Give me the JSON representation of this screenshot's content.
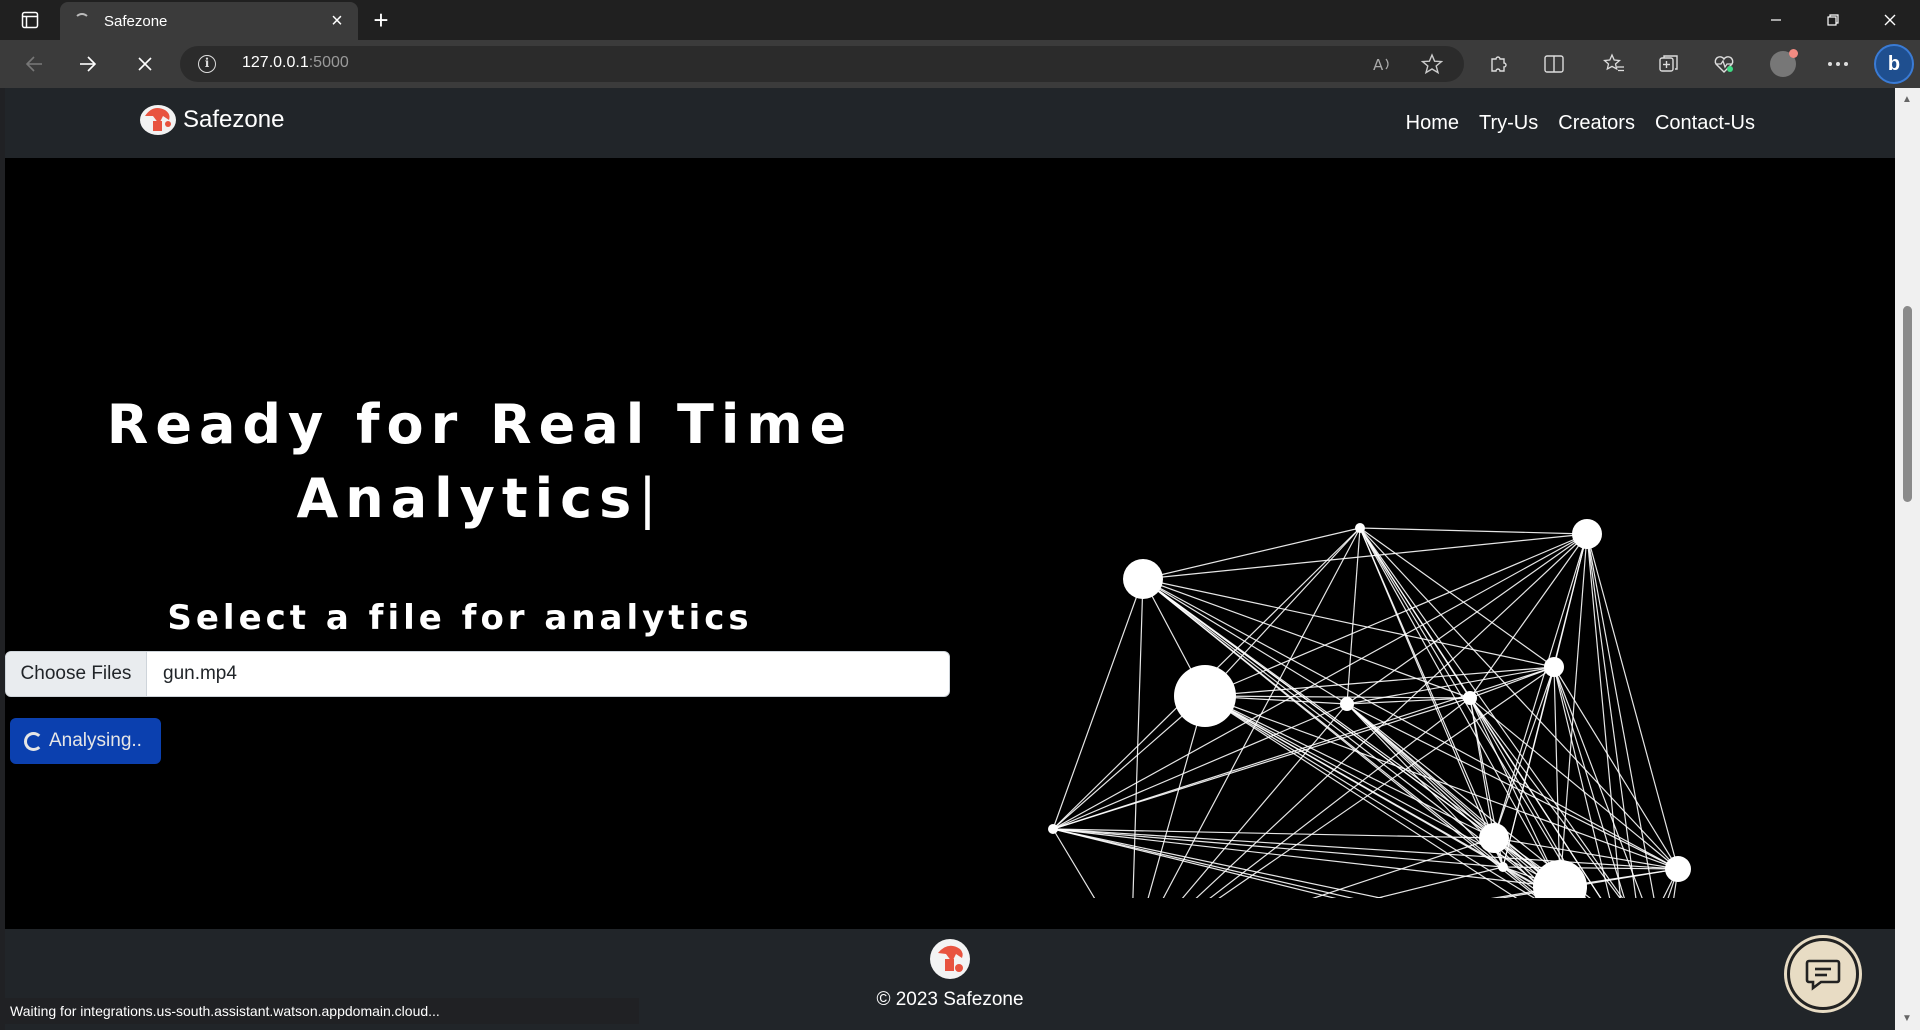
{
  "browser": {
    "tab_title": "Safezone",
    "tab_close": "×",
    "new_tab": "+",
    "url_host": "127.0.0.1",
    "url_port": ":5000",
    "status_text": "Waiting for integrations.us-south.assistant.watson.appdomain.cloud..."
  },
  "navbar": {
    "brand": "Safezone",
    "links": [
      "Home",
      "Try-Us",
      "Creators",
      "Contact-Us"
    ]
  },
  "hero": {
    "headline_line1": "Ready for Real Time",
    "headline_line2": "Analytics",
    "cursor": "|",
    "subheading": "Select a file for analytics",
    "file_button": "Choose Files",
    "file_name": "gun.mp4",
    "analyse_button": "Analysing.."
  },
  "footer": {
    "copyright": "© 2023 Safezone"
  },
  "icons": {
    "chat": "chat-bubble-icon",
    "logo": "safezone-logo"
  }
}
